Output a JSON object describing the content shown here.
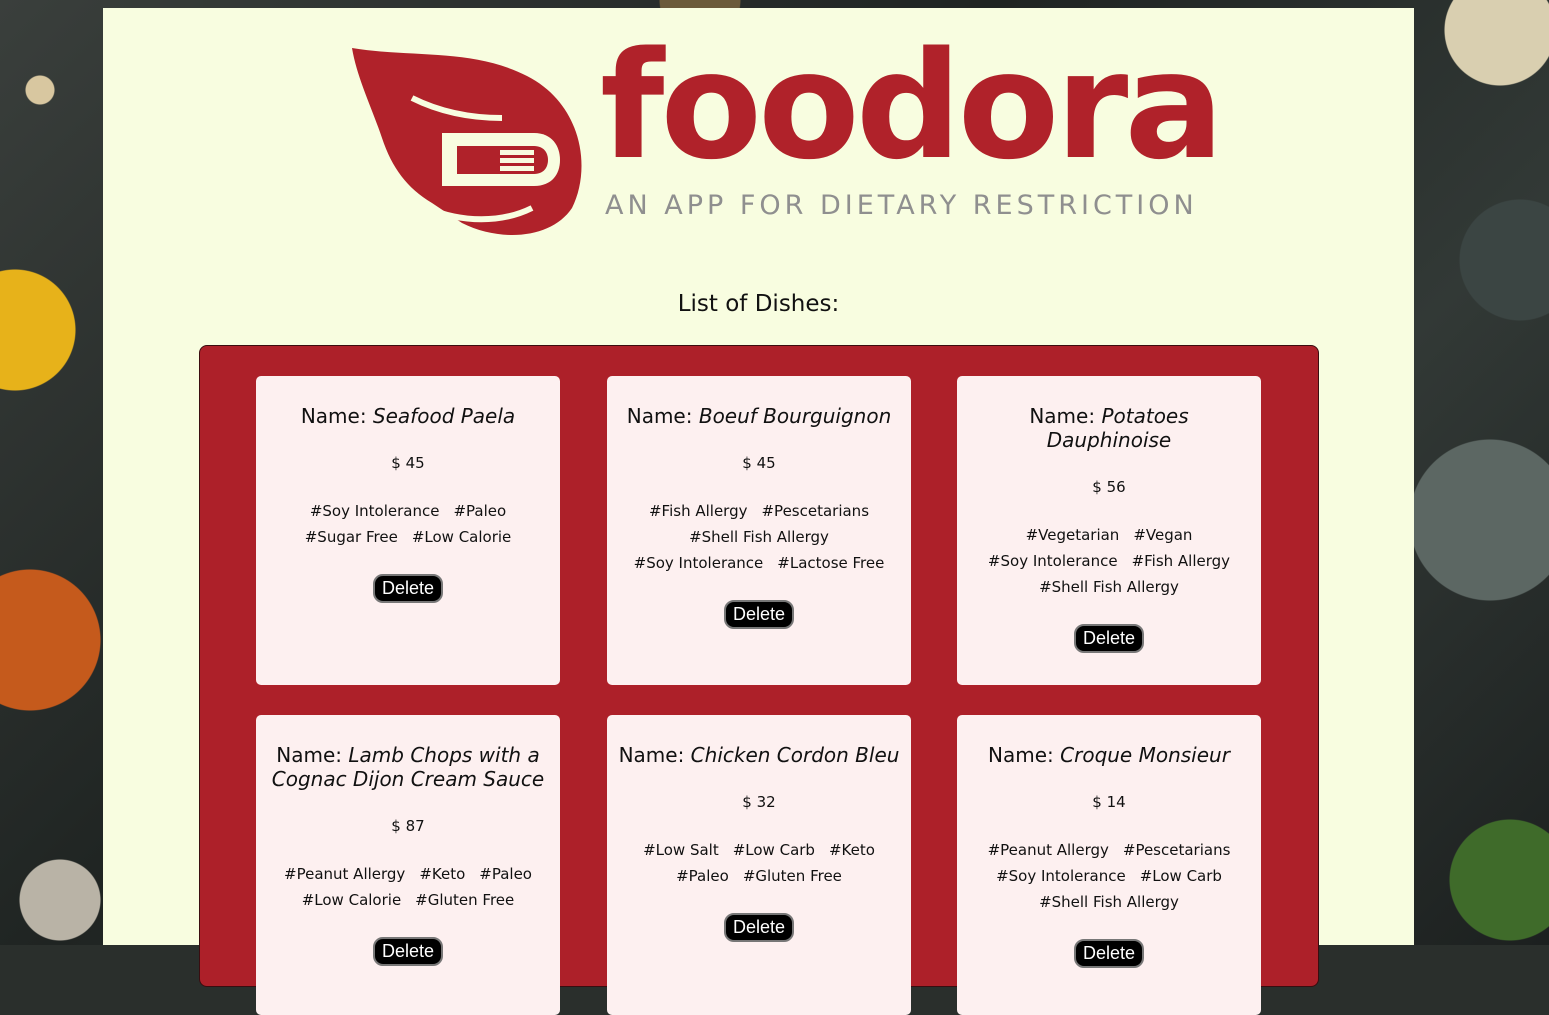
{
  "brand": {
    "name": "foodora",
    "tagline": "AN APP FOR DIETARY RESTRICTION",
    "color": "#b0222a"
  },
  "list_title": "List of Dishes:",
  "name_label": "Name:",
  "delete_label": "Delete",
  "dishes": [
    {
      "name": "Seafood Paela",
      "price": "$ 45",
      "tags": [
        "#Soy Intolerance",
        "#Paleo",
        "#Sugar Free",
        "#Low Calorie"
      ]
    },
    {
      "name": "Boeuf Bourguignon",
      "price": "$ 45",
      "tags": [
        "#Fish Allergy",
        "#Pescetarians",
        "#Shell Fish Allergy",
        "#Soy Intolerance",
        "#Lactose Free"
      ]
    },
    {
      "name": "Potatoes Dauphinoise",
      "price": "$ 56",
      "tags": [
        "#Vegetarian",
        "#Vegan",
        "#Soy Intolerance",
        "#Fish Allergy",
        "#Shell Fish Allergy"
      ]
    },
    {
      "name": "Lamb Chops with a Cognac Dijon Cream Sauce",
      "price": "$ 87",
      "tags": [
        "#Peanut Allergy",
        "#Keto",
        "#Paleo",
        "#Low Calorie",
        "#Gluten Free"
      ]
    },
    {
      "name": "Chicken Cordon Bleu",
      "price": "$ 32",
      "tags": [
        "#Low Salt",
        "#Low Carb",
        "#Keto",
        "#Paleo",
        "#Gluten Free"
      ]
    },
    {
      "name": "Croque Monsieur",
      "price": "$ 14",
      "tags": [
        "#Peanut Allergy",
        "#Pescetarians",
        "#Soy Intolerance",
        "#Low Carb",
        "#Shell Fish Allergy"
      ]
    }
  ]
}
